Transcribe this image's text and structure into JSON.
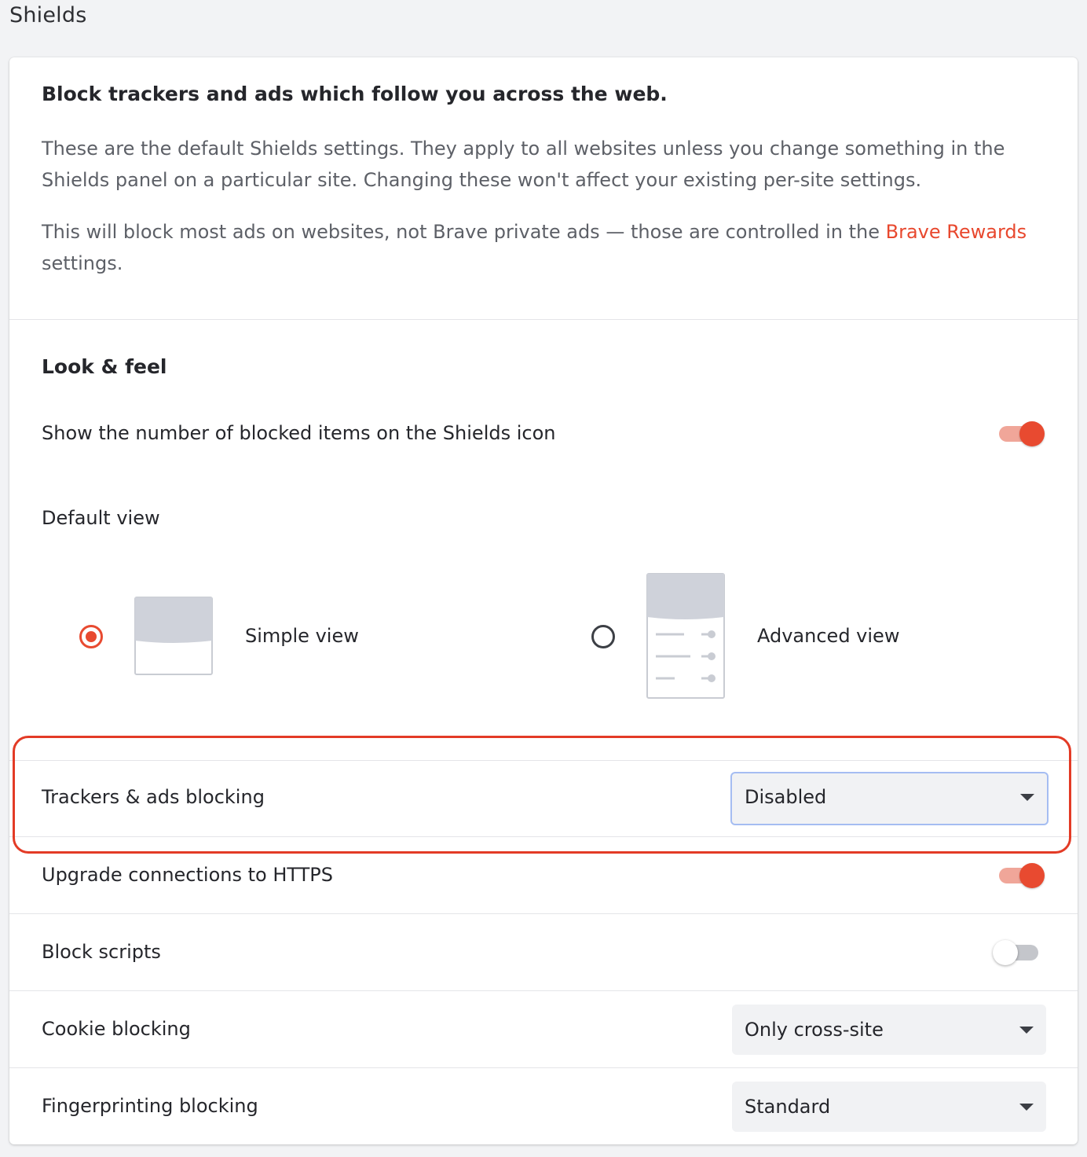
{
  "page": {
    "heading": "Shields"
  },
  "intro": {
    "title": "Block trackers and ads which follow you across the web.",
    "paragraph1": "These are the default Shields settings. They apply to all websites unless you change something in the Shields panel on a particular site. Changing these won't affect your existing per-site settings.",
    "paragraph2_before": "This will block most ads on websites, not Brave private ads — those are controlled in the ",
    "paragraph2_link": "Brave Rewards",
    "paragraph2_after": " settings."
  },
  "look_and_feel": {
    "title": "Look & feel",
    "show_count": {
      "label": "Show the number of blocked items on the Shields icon",
      "enabled": true
    },
    "default_view": {
      "label": "Default view",
      "options": [
        {
          "label": "Simple view",
          "selected": true
        },
        {
          "label": "Advanced view",
          "selected": false
        }
      ]
    }
  },
  "settings": {
    "trackers": {
      "label": "Trackers & ads blocking",
      "value": "Disabled"
    },
    "https": {
      "label": "Upgrade connections to HTTPS",
      "enabled": true
    },
    "scripts": {
      "label": "Block scripts",
      "enabled": false
    },
    "cookies": {
      "label": "Cookie blocking",
      "value": "Only cross-site"
    },
    "fingerprinting": {
      "label": "Fingerprinting blocking",
      "value": "Standard"
    }
  },
  "colors": {
    "accent": "#e84a30",
    "highlight_border": "#e33b26",
    "focus_ring": "#a5bdf2",
    "page_background": "#f2f3f5"
  },
  "icons": [
    "simple-view-illustration",
    "advanced-view-illustration",
    "chevron-down-icon"
  ]
}
